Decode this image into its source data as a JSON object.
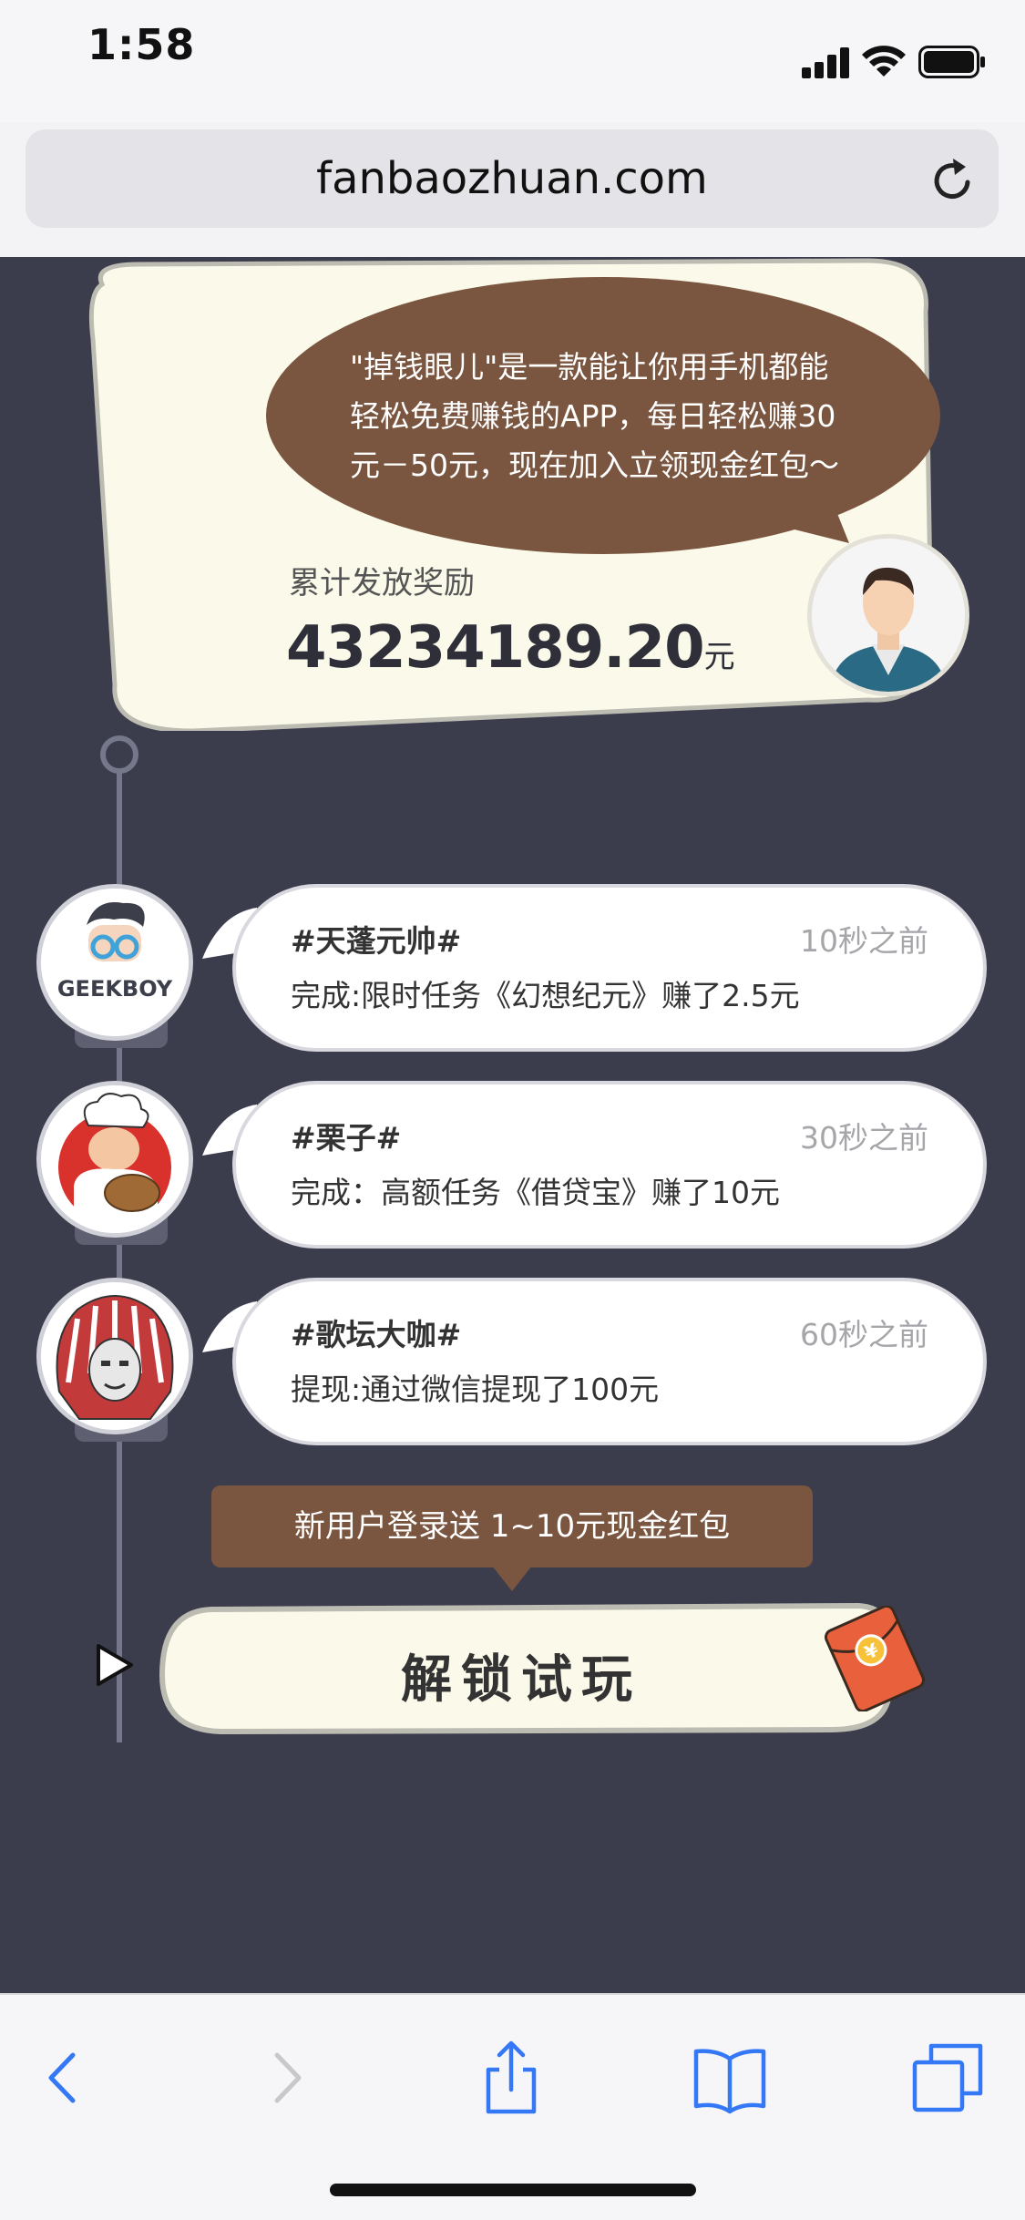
{
  "status_bar": {
    "time": "1:58"
  },
  "browser": {
    "url": "fanbaozhuan.com"
  },
  "intro": {
    "speech_lines": [
      "\"掉钱眼儿\"是一款能让你用手机都能",
      "轻松免费赚钱的APP，每日轻松赚30",
      "元－50元，现在加入立领现金红包～"
    ],
    "total_label": "累计发放奖励",
    "total_amount": "43234189.20",
    "total_unit": "元"
  },
  "feed": [
    {
      "name": "#天蓬元帅#",
      "time": "10秒之前",
      "desc": "完成:限时任务《幻想纪元》赚了2.5元",
      "avatar": "geekboy-avatar",
      "avatar_text": "GEEKBOY"
    },
    {
      "name": "#栗子#",
      "time": "30秒之前",
      "desc": "完成：高额任务《借贷宝》赚了10元",
      "avatar": "chef-avatar"
    },
    {
      "name": "#歌坛大咖#",
      "time": "60秒之前",
      "desc": "提现:通过微信提现了100元",
      "avatar": "chief-avatar"
    }
  ],
  "promo": {
    "tag": "新用户登录送 1~10元现金红包",
    "button": "解锁试玩",
    "redpacket_symbol": "¥"
  },
  "colors": {
    "page_bg": "#3b3d4c",
    "brown": "#7a553f",
    "cream": "#fbfaea",
    "accent_red": "#e8603c",
    "ios_blue": "#3478f6"
  },
  "toolbar": {
    "icons": [
      "back-icon",
      "forward-icon",
      "share-icon",
      "bookmarks-icon",
      "tabs-icon"
    ]
  }
}
